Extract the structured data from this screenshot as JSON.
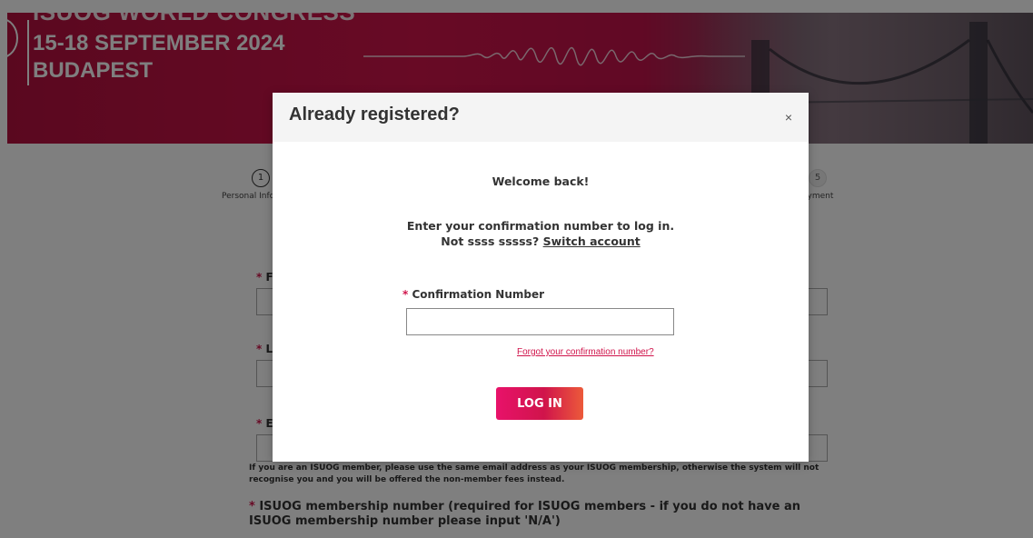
{
  "banner": {
    "line1": "ISUOG WORLD CONGRESS",
    "line2": "15-18 SEPTEMBER 2024",
    "line3": "BUDAPEST"
  },
  "steps": {
    "step1_number": "1",
    "step1_label": "Personal Info",
    "step5_number": "5",
    "step5_label": "Payment"
  },
  "form": {
    "field1_label_initial": "F",
    "field2_label_initial": "L",
    "field3_label_initial": "E",
    "required_marker": "*",
    "email_note": "If you are an ISUOG member, please use the same email address as your ISUOG membership, otherwise the system will not recognise you and you will be offered the non-member fees instead.",
    "membership_label": "ISUOG membership number (required for ISUOG members - if you do not have an ISUOG membership number please input 'N/A')"
  },
  "modal": {
    "title": "Already registered?",
    "close_symbol": "×",
    "welcome": "Welcome back!",
    "instruction": "Enter your confirmation number to log in.",
    "not_user_prefix": "Not ssss sssss?",
    "switch_account": "Switch account",
    "required_marker": "*",
    "confirmation_label": "Confirmation Number",
    "confirmation_value": "",
    "forgot_link": "Forgot your confirmation number?",
    "login_button": "LOG IN"
  },
  "colors": {
    "brand": "#d0144b",
    "overlay": "rgba(0,0,0,0.5)"
  }
}
